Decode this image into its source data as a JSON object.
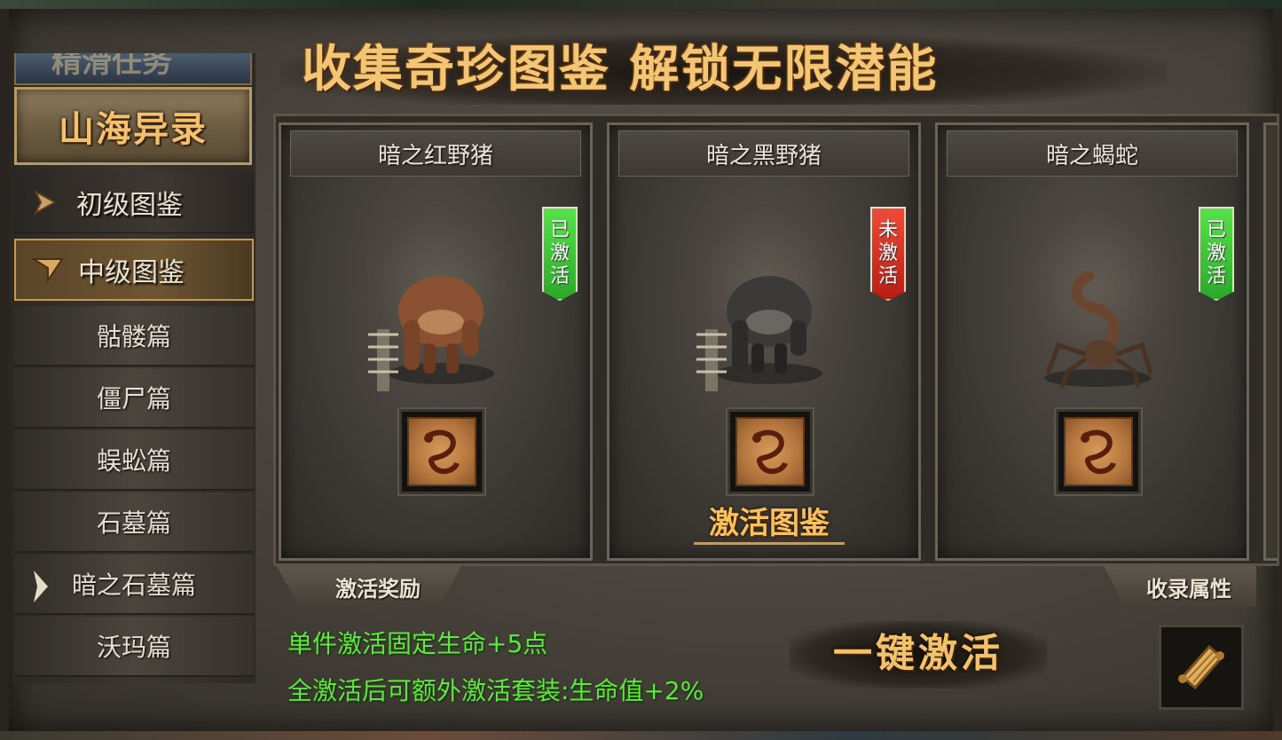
{
  "header": {
    "title": "收集奇珍图鉴 解锁无限潜能"
  },
  "sidebar": {
    "top_stub_label": "精滑任务",
    "section_title": "山海异录",
    "categories": [
      {
        "label": "初级图鉴",
        "icon": "chevron-right-icon",
        "state": "collapsed"
      },
      {
        "label": "中级图鉴",
        "icon": "chevron-down-icon",
        "state": "expanded"
      }
    ],
    "subitems": [
      {
        "label": "骷髅篇"
      },
      {
        "label": "僵尸篇"
      },
      {
        "label": "蜈蚣篇"
      },
      {
        "label": "石墓篇"
      },
      {
        "label": "暗之石墓篇",
        "selected": true
      },
      {
        "label": "沃玛篇"
      }
    ]
  },
  "cards": [
    {
      "name": "暗之红野猪",
      "status": [
        "已",
        "激",
        "活"
      ],
      "status_color": "#3fc43a",
      "monster_icon": "red-boar-icon",
      "item_icon": "dragon-emblem-icon",
      "monster_color": "#8a5232"
    },
    {
      "name": "暗之黑野猪",
      "status": [
        "未",
        "激",
        "活"
      ],
      "status_color": "#d8301f",
      "monster_icon": "black-boar-icon",
      "item_icon": "dragon-emblem-icon",
      "monster_color": "#3c3a38",
      "action_label": "激活图鉴"
    },
    {
      "name": "暗之蝎蛇",
      "status": [
        "已",
        "激",
        "活"
      ],
      "status_color": "#3fc43a",
      "monster_icon": "scorpion-snake-icon",
      "item_icon": "dragon-emblem-icon",
      "monster_color": "#5a3e2c"
    }
  ],
  "bottom": {
    "reward_tab": "激活奖励",
    "attr_tab": "收录属性",
    "reward_lines": [
      "单件激活固定生命+5点",
      "全激活后可额外激活套装:生命值+2%"
    ],
    "onekey_label": "一键激活",
    "scroll_icon": "scroll-icon"
  },
  "colors": {
    "gold_text": "#f3c676",
    "reward_green": "#5ee83a",
    "active_green": "#3fc43a",
    "inactive_red": "#d8301f"
  }
}
